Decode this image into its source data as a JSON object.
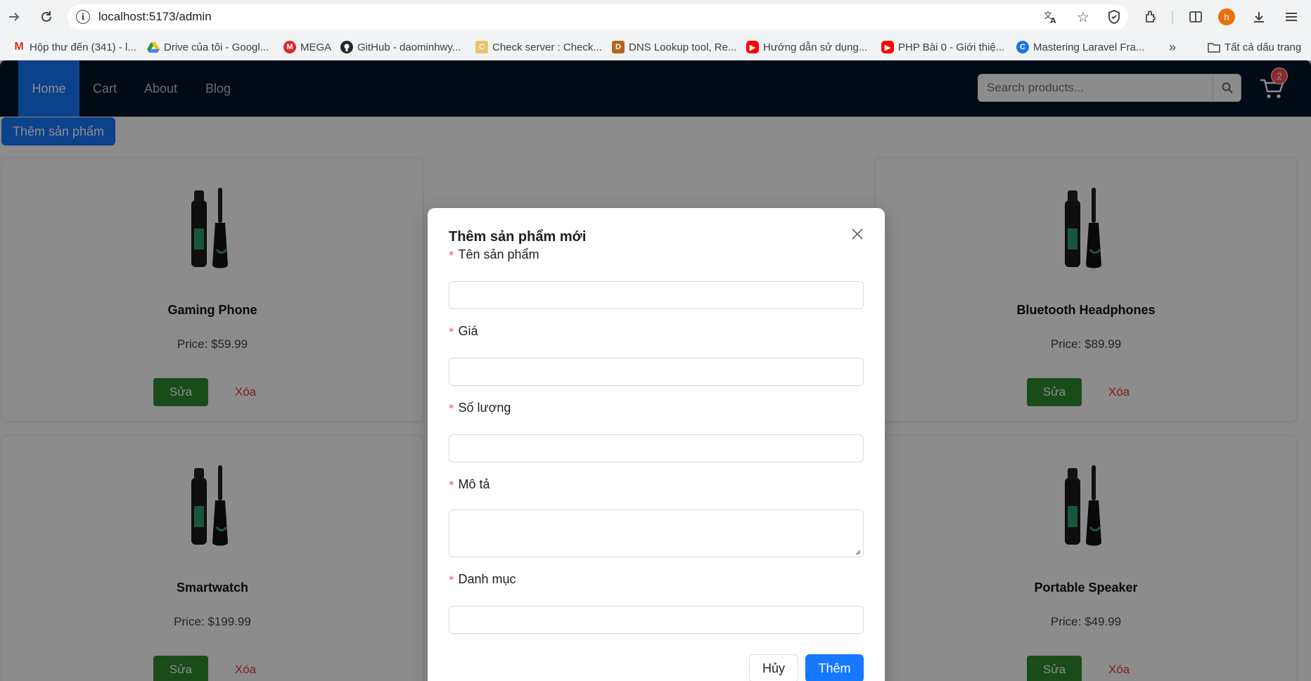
{
  "browser": {
    "url": "localhost:5173/admin",
    "bookmarks": [
      {
        "label": "Hộp thư đến (341) - l...",
        "icon": "gmail-icon"
      },
      {
        "label": "Drive của tôi - Googl...",
        "icon": "drive-icon"
      },
      {
        "label": "MEGA",
        "icon": "mega-icon"
      },
      {
        "label": "GitHub - daominhwy...",
        "icon": "github-icon"
      },
      {
        "label": "Check server : Check...",
        "icon": "check-server-icon"
      },
      {
        "label": "DNS Lookup tool, Re...",
        "icon": "dns-icon"
      },
      {
        "label": "Hướng dẫn sử dụng...",
        "icon": "youtube-icon"
      },
      {
        "label": "PHP Bài 0 - Giới thiệ...",
        "icon": "youtube-icon"
      },
      {
        "label": "Mastering Laravel Fra...",
        "icon": "c-icon"
      }
    ],
    "all_bookmarks_label": "Tất cả dấu trang",
    "profile_initial": "h"
  },
  "nav": {
    "items": [
      "Home",
      "Cart",
      "About",
      "Blog"
    ],
    "active": "Home",
    "search_placeholder": "Search products...",
    "cart_count": "2"
  },
  "add_product_label": "Thêm sản phẩm",
  "products": [
    {
      "name": "Gaming Phone",
      "price": "Price: $59.99"
    },
    {
      "name": "Bluetooth Headphones",
      "price": "Price: $89.99"
    },
    {
      "name": "Smartwatch",
      "price": "Price: $199.99"
    },
    {
      "name": "Portable Speaker",
      "price": "Price: $49.99"
    }
  ],
  "edit_label": "Sửa",
  "delete_label": "Xóa",
  "modal": {
    "title": "Thêm sản phẩm mới",
    "fields": {
      "name": {
        "label": "Tên sản phẩm",
        "value": ""
      },
      "price": {
        "label": "Giá",
        "value": ""
      },
      "quantity": {
        "label": "Số lượng",
        "value": ""
      },
      "description": {
        "label": "Mô tả",
        "value": ""
      },
      "category": {
        "label": "Danh mục",
        "value": ""
      }
    },
    "cancel_label": "Hủy",
    "submit_label": "Thêm"
  },
  "colors": {
    "nav_bg": "#001529",
    "primary": "#1677ff",
    "edit_green": "#2e8b2e",
    "danger": "#e53935"
  }
}
